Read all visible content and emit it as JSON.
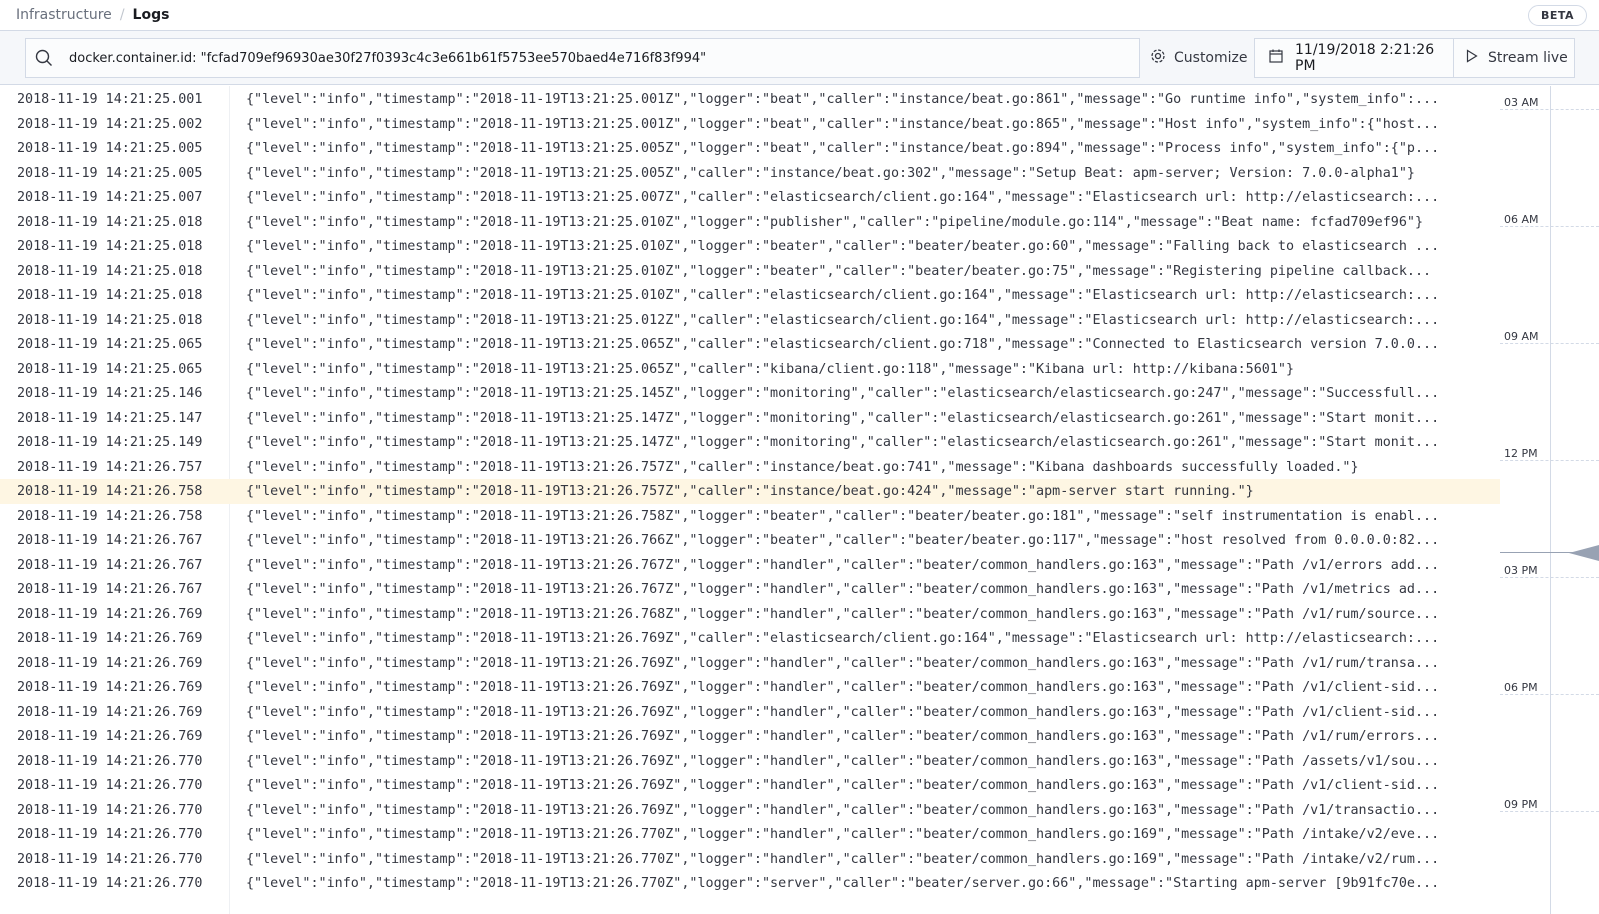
{
  "breadcrumb": {
    "parent": "Infrastructure",
    "separator": "/",
    "current": "Logs"
  },
  "beta_badge": "BETA",
  "toolbar": {
    "query": "docker.container.id: \"fcfad709ef96930ae30f27f0393c4c3e661b61f5753ee570baed4e716f83f994\"",
    "customize_label": "Customize",
    "date": "11/19/2018 2:21:26 PM",
    "stream_label": "Stream live",
    "icons": {
      "search": "search-icon",
      "customize": "gear-icon",
      "date": "calendar-icon",
      "stream": "play-icon"
    }
  },
  "highlight_index": 16,
  "log_rows": [
    {
      "ts": "2018-11-19 14:21:25.001",
      "msg": "{\"level\":\"info\",\"timestamp\":\"2018-11-19T13:21:25.001Z\",\"logger\":\"beat\",\"caller\":\"instance/beat.go:861\",\"message\":\"Go runtime info\",\"system_info\":..."
    },
    {
      "ts": "2018-11-19 14:21:25.002",
      "msg": "{\"level\":\"info\",\"timestamp\":\"2018-11-19T13:21:25.001Z\",\"logger\":\"beat\",\"caller\":\"instance/beat.go:865\",\"message\":\"Host info\",\"system_info\":{\"host..."
    },
    {
      "ts": "2018-11-19 14:21:25.005",
      "msg": "{\"level\":\"info\",\"timestamp\":\"2018-11-19T13:21:25.005Z\",\"logger\":\"beat\",\"caller\":\"instance/beat.go:894\",\"message\":\"Process info\",\"system_info\":{\"p..."
    },
    {
      "ts": "2018-11-19 14:21:25.005",
      "msg": "{\"level\":\"info\",\"timestamp\":\"2018-11-19T13:21:25.005Z\",\"caller\":\"instance/beat.go:302\",\"message\":\"Setup Beat: apm-server; Version: 7.0.0-alpha1\"}"
    },
    {
      "ts": "2018-11-19 14:21:25.007",
      "msg": "{\"level\":\"info\",\"timestamp\":\"2018-11-19T13:21:25.007Z\",\"caller\":\"elasticsearch/client.go:164\",\"message\":\"Elasticsearch url: http://elasticsearch:..."
    },
    {
      "ts": "2018-11-19 14:21:25.018",
      "msg": "{\"level\":\"info\",\"timestamp\":\"2018-11-19T13:21:25.010Z\",\"logger\":\"publisher\",\"caller\":\"pipeline/module.go:114\",\"message\":\"Beat name: fcfad709ef96\"}"
    },
    {
      "ts": "2018-11-19 14:21:25.018",
      "msg": "{\"level\":\"info\",\"timestamp\":\"2018-11-19T13:21:25.010Z\",\"logger\":\"beater\",\"caller\":\"beater/beater.go:60\",\"message\":\"Falling back to elasticsearch ..."
    },
    {
      "ts": "2018-11-19 14:21:25.018",
      "msg": "{\"level\":\"info\",\"timestamp\":\"2018-11-19T13:21:25.010Z\",\"logger\":\"beater\",\"caller\":\"beater/beater.go:75\",\"message\":\"Registering pipeline callback..."
    },
    {
      "ts": "2018-11-19 14:21:25.018",
      "msg": "{\"level\":\"info\",\"timestamp\":\"2018-11-19T13:21:25.010Z\",\"caller\":\"elasticsearch/client.go:164\",\"message\":\"Elasticsearch url: http://elasticsearch:..."
    },
    {
      "ts": "2018-11-19 14:21:25.018",
      "msg": "{\"level\":\"info\",\"timestamp\":\"2018-11-19T13:21:25.012Z\",\"caller\":\"elasticsearch/client.go:164\",\"message\":\"Elasticsearch url: http://elasticsearch:..."
    },
    {
      "ts": "2018-11-19 14:21:25.065",
      "msg": "{\"level\":\"info\",\"timestamp\":\"2018-11-19T13:21:25.065Z\",\"caller\":\"elasticsearch/client.go:718\",\"message\":\"Connected to Elasticsearch version 7.0.0..."
    },
    {
      "ts": "2018-11-19 14:21:25.065",
      "msg": "{\"level\":\"info\",\"timestamp\":\"2018-11-19T13:21:25.065Z\",\"caller\":\"kibana/client.go:118\",\"message\":\"Kibana url: http://kibana:5601\"}"
    },
    {
      "ts": "2018-11-19 14:21:25.146",
      "msg": "{\"level\":\"info\",\"timestamp\":\"2018-11-19T13:21:25.145Z\",\"logger\":\"monitoring\",\"caller\":\"elasticsearch/elasticsearch.go:247\",\"message\":\"Successfull..."
    },
    {
      "ts": "2018-11-19 14:21:25.147",
      "msg": "{\"level\":\"info\",\"timestamp\":\"2018-11-19T13:21:25.147Z\",\"logger\":\"monitoring\",\"caller\":\"elasticsearch/elasticsearch.go:261\",\"message\":\"Start monit..."
    },
    {
      "ts": "2018-11-19 14:21:25.149",
      "msg": "{\"level\":\"info\",\"timestamp\":\"2018-11-19T13:21:25.147Z\",\"logger\":\"monitoring\",\"caller\":\"elasticsearch/elasticsearch.go:261\",\"message\":\"Start monit..."
    },
    {
      "ts": "2018-11-19 14:21:26.757",
      "msg": "{\"level\":\"info\",\"timestamp\":\"2018-11-19T13:21:26.757Z\",\"caller\":\"instance/beat.go:741\",\"message\":\"Kibana dashboards successfully loaded.\"}"
    },
    {
      "ts": "2018-11-19 14:21:26.758",
      "msg": "{\"level\":\"info\",\"timestamp\":\"2018-11-19T13:21:26.757Z\",\"caller\":\"instance/beat.go:424\",\"message\":\"apm-server start running.\"}"
    },
    {
      "ts": "2018-11-19 14:21:26.758",
      "msg": "{\"level\":\"info\",\"timestamp\":\"2018-11-19T13:21:26.758Z\",\"logger\":\"beater\",\"caller\":\"beater/beater.go:181\",\"message\":\"self instrumentation is enabl..."
    },
    {
      "ts": "2018-11-19 14:21:26.767",
      "msg": "{\"level\":\"info\",\"timestamp\":\"2018-11-19T13:21:26.766Z\",\"logger\":\"beater\",\"caller\":\"beater/beater.go:117\",\"message\":\"host resolved from 0.0.0.0:82..."
    },
    {
      "ts": "2018-11-19 14:21:26.767",
      "msg": "{\"level\":\"info\",\"timestamp\":\"2018-11-19T13:21:26.767Z\",\"logger\":\"handler\",\"caller\":\"beater/common_handlers.go:163\",\"message\":\"Path /v1/errors add..."
    },
    {
      "ts": "2018-11-19 14:21:26.767",
      "msg": "{\"level\":\"info\",\"timestamp\":\"2018-11-19T13:21:26.767Z\",\"logger\":\"handler\",\"caller\":\"beater/common_handlers.go:163\",\"message\":\"Path /v1/metrics ad..."
    },
    {
      "ts": "2018-11-19 14:21:26.769",
      "msg": "{\"level\":\"info\",\"timestamp\":\"2018-11-19T13:21:26.768Z\",\"logger\":\"handler\",\"caller\":\"beater/common_handlers.go:163\",\"message\":\"Path /v1/rum/source..."
    },
    {
      "ts": "2018-11-19 14:21:26.769",
      "msg": "{\"level\":\"info\",\"timestamp\":\"2018-11-19T13:21:26.769Z\",\"caller\":\"elasticsearch/client.go:164\",\"message\":\"Elasticsearch url: http://elasticsearch:..."
    },
    {
      "ts": "2018-11-19 14:21:26.769",
      "msg": "{\"level\":\"info\",\"timestamp\":\"2018-11-19T13:21:26.769Z\",\"logger\":\"handler\",\"caller\":\"beater/common_handlers.go:163\",\"message\":\"Path /v1/rum/transa..."
    },
    {
      "ts": "2018-11-19 14:21:26.769",
      "msg": "{\"level\":\"info\",\"timestamp\":\"2018-11-19T13:21:26.769Z\",\"logger\":\"handler\",\"caller\":\"beater/common_handlers.go:163\",\"message\":\"Path /v1/client-sid..."
    },
    {
      "ts": "2018-11-19 14:21:26.769",
      "msg": "{\"level\":\"info\",\"timestamp\":\"2018-11-19T13:21:26.769Z\",\"logger\":\"handler\",\"caller\":\"beater/common_handlers.go:163\",\"message\":\"Path /v1/client-sid..."
    },
    {
      "ts": "2018-11-19 14:21:26.769",
      "msg": "{\"level\":\"info\",\"timestamp\":\"2018-11-19T13:21:26.769Z\",\"logger\":\"handler\",\"caller\":\"beater/common_handlers.go:163\",\"message\":\"Path /v1/rum/errors..."
    },
    {
      "ts": "2018-11-19 14:21:26.770",
      "msg": "{\"level\":\"info\",\"timestamp\":\"2018-11-19T13:21:26.769Z\",\"logger\":\"handler\",\"caller\":\"beater/common_handlers.go:163\",\"message\":\"Path /assets/v1/sou..."
    },
    {
      "ts": "2018-11-19 14:21:26.770",
      "msg": "{\"level\":\"info\",\"timestamp\":\"2018-11-19T13:21:26.769Z\",\"logger\":\"handler\",\"caller\":\"beater/common_handlers.go:163\",\"message\":\"Path /v1/client-sid..."
    },
    {
      "ts": "2018-11-19 14:21:26.770",
      "msg": "{\"level\":\"info\",\"timestamp\":\"2018-11-19T13:21:26.769Z\",\"logger\":\"handler\",\"caller\":\"beater/common_handlers.go:163\",\"message\":\"Path /v1/transactio..."
    },
    {
      "ts": "2018-11-19 14:21:26.770",
      "msg": "{\"level\":\"info\",\"timestamp\":\"2018-11-19T13:21:26.770Z\",\"logger\":\"handler\",\"caller\":\"beater/common_handlers.go:169\",\"message\":\"Path /intake/v2/eve..."
    },
    {
      "ts": "2018-11-19 14:21:26.770",
      "msg": "{\"level\":\"info\",\"timestamp\":\"2018-11-19T13:21:26.770Z\",\"logger\":\"handler\",\"caller\":\"beater/common_handlers.go:169\",\"message\":\"Path /intake/v2/rum..."
    },
    {
      "ts": "2018-11-19 14:21:26.770",
      "msg": "{\"level\":\"info\",\"timestamp\":\"2018-11-19T13:21:26.770Z\",\"logger\":\"server\",\"caller\":\"beater/server.go:66\",\"message\":\"Starting apm-server [9b91fc70e..."
    }
  ],
  "minimap": {
    "ticks": [
      "03 AM",
      "06 AM",
      "09 AM",
      "12 PM",
      "03 PM",
      "06 PM",
      "09 PM"
    ]
  },
  "colors": {
    "highlight": "#fef6e3",
    "border": "#d3dae6",
    "toolbar_bg": "#f5f7fa",
    "text": "#343741"
  }
}
